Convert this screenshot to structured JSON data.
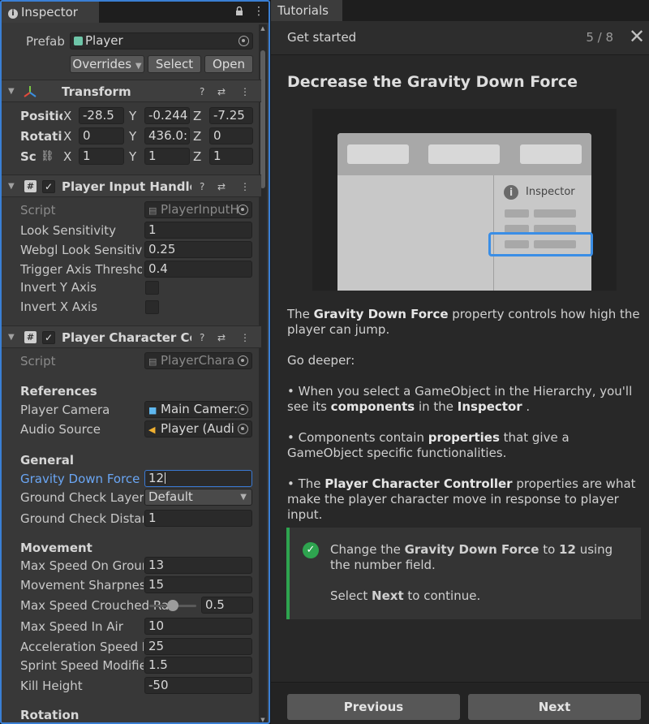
{
  "inspector": {
    "tab_label": "Inspector",
    "prefab": {
      "label": "Prefab",
      "value": "Player",
      "overrides_label": "Overrides",
      "select_label": "Select",
      "open_label": "Open"
    },
    "transform": {
      "title": "Transform",
      "rows": [
        {
          "label": "Positic",
          "x": "-28.5",
          "y": "-0.244",
          "z": "-7.25"
        },
        {
          "label": "Rotatic",
          "x": "0",
          "y": "436.0:",
          "z": "0"
        },
        {
          "label": "Sc",
          "x": "1",
          "y": "1",
          "z": "1"
        }
      ],
      "axis_x": "X",
      "axis_y": "Y",
      "axis_z": "Z"
    },
    "input_handler": {
      "title": "Player Input Handler (",
      "script_label": "Script",
      "script_value": "PlayerInputH",
      "look_sensitivity_label": "Look Sensitivity",
      "look_sensitivity_value": "1",
      "webgl_label": "Webgl Look Sensitivit",
      "webgl_value": "0.25",
      "trigger_label": "Trigger Axis Thresho",
      "trigger_value": "0.4",
      "invert_y_label": "Invert Y Axis",
      "invert_x_label": "Invert X Axis"
    },
    "character_controller": {
      "title": "Player Character Con",
      "script_label": "Script",
      "script_value": "PlayerChara",
      "references_header": "References",
      "camera_label": "Player Camera",
      "camera_value": "Main Camer:",
      "audio_label": "Audio Source",
      "audio_value": "Player (Audi",
      "general_header": "General",
      "gravity_label": "Gravity Down Force",
      "gravity_value": "12",
      "ground_layers_label": "Ground Check Layers",
      "ground_layers_value": "Default",
      "ground_distance_label": "Ground Check Distan",
      "ground_distance_value": "1",
      "movement_header": "Movement",
      "max_speed_ground_label": "Max Speed On Groun",
      "max_speed_ground_value": "13",
      "sharpness_label": "Movement Sharpness",
      "sharpness_value": "15",
      "crouched_label": "Max Speed Crouched Rat",
      "crouched_value": "0.5",
      "crouched_fraction": 0.5,
      "air_label": "Max Speed In Air",
      "air_value": "10",
      "accel_label": "Acceleration Speed In",
      "accel_value": "25",
      "sprint_label": "Sprint Speed Modifie",
      "sprint_value": "1.5",
      "kill_label": "Kill Height",
      "kill_value": "-50",
      "rotation_header": "Rotation"
    }
  },
  "tutorials": {
    "tab_label": "Tutorials",
    "header_title": "Get started",
    "page_indicator": "5 / 8",
    "step_title": "Decrease the Gravity Down Force",
    "illustration_label": "Inspector",
    "para1_pre": "The ",
    "para1_bold": "Gravity Down Force",
    "para1_post": " property controls how high the player can jump.",
    "go_deeper": "Go deeper:",
    "b1_pre": "• When you select a GameObject in the Hierarchy, you'll see its ",
    "b1_bold1": "components",
    "b1_mid": " in the ",
    "b1_bold2": "Inspector",
    "b1_post": " .",
    "b2_pre": "• Components contain ",
    "b2_bold": "properties",
    "b2_post": " that give a GameObject specific functionalities.",
    "b3_pre": "• The ",
    "b3_bold": "Player Character Controller",
    "b3_post": " properties are what make the player character move in response to player input.",
    "task_pre": "Change the ",
    "task_bold1": "Gravity Down Force",
    "task_mid": " to ",
    "task_bold2": "12",
    "task_post": " using the number field.",
    "task2_pre": "Select ",
    "task2_bold": "Next",
    "task2_post": " to continue.",
    "previous_label": "Previous",
    "next_label": "Next"
  },
  "colors": {
    "accent": "#3a7fd4",
    "success": "#2ea44f",
    "active_label": "#6aa6f4"
  }
}
